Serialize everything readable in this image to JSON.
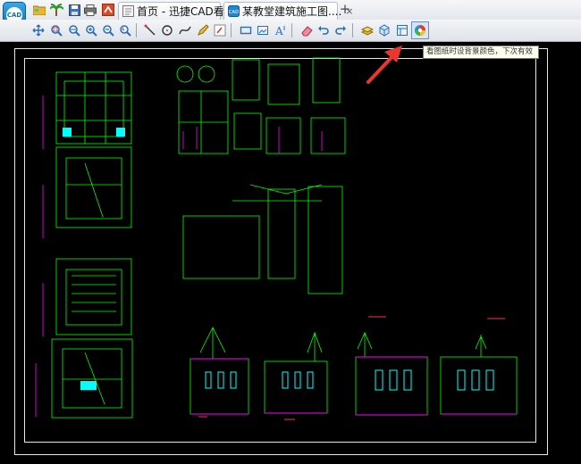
{
  "app": {
    "logo_text": "CAD"
  },
  "tabs": [
    {
      "label": "首页 - 迅捷CAD看图",
      "active": false
    },
    {
      "label": "某教堂建筑施工图....",
      "active": true,
      "close": "×"
    }
  ],
  "tab_new": "+",
  "tooltip": "看图纸时设背景颜色，下次有效",
  "colors": {
    "accent": "#0b6fb8",
    "canvas_bg": "#000000",
    "cad_green": "#00ff00",
    "cad_magenta": "#ff00ff",
    "cad_cyan": "#00ffff",
    "arrow_red": "#e8382d"
  },
  "quick_access": [
    "folder-icon",
    "palm-tree-icon",
    "save-icon",
    "print-icon",
    "export-icon"
  ],
  "toolbar": [
    "pan-icon",
    "zoom-window-icon",
    "zoom-extents-icon",
    "zoom-in-icon",
    "zoom-out-icon",
    "zoom-previous-icon",
    "line-icon",
    "circle-icon",
    "polyline-icon",
    "pencil-icon",
    "text-edit-icon",
    "rectangle-icon",
    "image-icon",
    "text-icon",
    "eraser-icon",
    "undo-icon",
    "redo-icon",
    "layer-icon",
    "3d-view-icon",
    "layout-icon",
    "background-color-icon"
  ]
}
